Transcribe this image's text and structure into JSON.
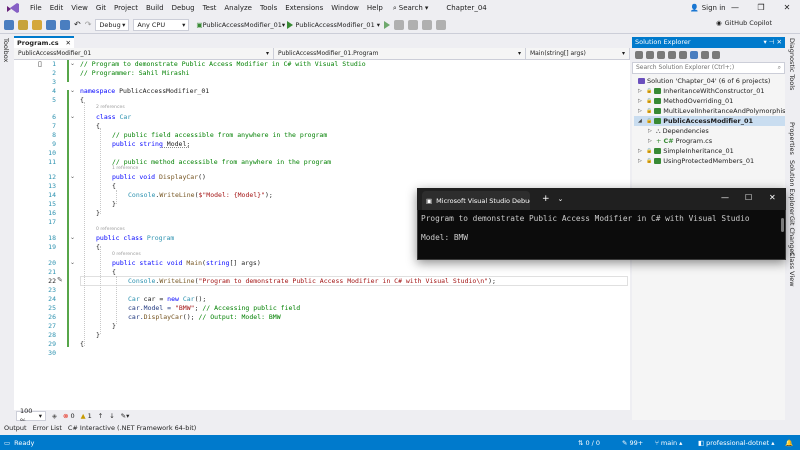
{
  "menu": {
    "items": [
      "File",
      "Edit",
      "View",
      "Git",
      "Project",
      "Build",
      "Debug",
      "Test",
      "Analyze",
      "Tools",
      "Extensions",
      "Window",
      "Help"
    ],
    "search_label": "Search",
    "solution_name": "Chapter_04",
    "sign_in": "Sign in"
  },
  "toolbar": {
    "config": "Debug",
    "platform": "Any CPU",
    "startup_project": "PublicAccessModifier_01",
    "run_label": "PublicAccessModifier_01",
    "copilot": "GitHub Copilot"
  },
  "left_strip": "Toolbox",
  "editor": {
    "tab": "Program.cs",
    "nav_project": "PublicAccessModifier_01",
    "nav_class": "PublicAccessModifier_01.Program",
    "nav_member": "Main(string[] args)",
    "lens_2": "2 references",
    "lens_1": "1 reference",
    "lens_0": "0 references",
    "line_numbers": [
      "1",
      "2",
      "3",
      "4",
      "5",
      "6",
      "7",
      "8",
      "9",
      "10",
      "11",
      "12",
      "13",
      "14",
      "15",
      "16",
      "17",
      "18",
      "19",
      "20",
      "21",
      "22",
      "23",
      "24",
      "25",
      "26",
      "27",
      "28",
      "29",
      "30"
    ],
    "code": {
      "l1": "// Program to demonstrate Public Access Modifier in C# with Visual Studio",
      "l2": "// Programmer: Sahil Mirashi",
      "l4_kw": "namespace",
      "l4_name": " PublicAccessModifier_01",
      "l5": "{",
      "l6_kw": "class",
      "l6_name": " Car",
      "l7": "{",
      "l8": "// public field accessible from anywhere in the program",
      "l9_kw1": "public",
      "l9_kw2": " string",
      "l9_rest": " Model;",
      "l11": "// public method accessible from anywhere in the program",
      "l12_kw1": "public",
      "l12_kw2": " void",
      "l12_name": " DisplayCar",
      "l12_rest": "()",
      "l13": "{",
      "l14_type": "Console",
      "l14_mid": ".",
      "l14_method": "WriteLine",
      "l14_open": "(",
      "l14_str": "$\"Model: {Model}\"",
      "l14_end": ");",
      "l15": "}",
      "l16": "}",
      "l18_kw1": "public",
      "l18_kw2": " class",
      "l18_name": " Program",
      "l19": "{",
      "l20_kw1": "public",
      "l20_kw2": " static",
      "l20_kw3": " void",
      "l20_name": " Main",
      "l20_open": "(",
      "l20_kw4": "string",
      "l20_rest": "[] args)",
      "l21": "{",
      "l22_type": "Console",
      "l22_mid": ".",
      "l22_method": "WriteLine",
      "l22_open": "(",
      "l22_str": "\"Program to demonstrate Public Access Modifier in C# with Visual Studio\\n\"",
      "l22_end": ");",
      "l24_type1": "Car",
      "l24_mid": " car = ",
      "l24_kw": "new",
      "l24_type2": " Car",
      "l24_end": "();",
      "l25_pre": "car.Model = ",
      "l25_str": "\"BMW\"",
      "l25_mid": "; ",
      "l25_cmt": "// Accessing public field",
      "l26_pre": "car.",
      "l26_method": "DisplayCar",
      "l26_mid": "(); ",
      "l26_cmt": "// Output: Model: BMW",
      "l27": "}",
      "l28": "}"
    },
    "zoom": "100 %",
    "errors": "0",
    "warnings": "1"
  },
  "bottom_tabs": [
    "Output",
    "Error List",
    "C# Interactive (.NET Framework 64-bit)"
  ],
  "status": {
    "ready": "Ready",
    "changes": "0 / 0",
    "commits": "99+",
    "branch": "main",
    "repo": "professional-dotnet"
  },
  "solution_explorer": {
    "title": "Solution Explorer",
    "search_placeholder": "Search Solution Explorer (Ctrl+;)",
    "solution": "Solution 'Chapter_04' (6 of 6 projects)",
    "projects": [
      "InheritanceWithConstructor_01",
      "MethodOverriding_01",
      "MultiLevelInheritanceAndPolymorphism_01",
      "PublicAccessModifier_01"
    ],
    "dependencies": "Dependencies",
    "file": "Program.cs",
    "more_projects": [
      "SimpleInheritance_01",
      "UsingProtectedMembers_01"
    ]
  },
  "right_strip": [
    "Diagnostic Tools",
    "Properties",
    "Solution Explorer",
    "Git Changes",
    "Class View"
  ],
  "console": {
    "tab_title": "Microsoft Visual Studio Debug",
    "output": [
      "Program to demonstrate Public Access Modifier in C# with Visual Studio",
      "",
      "Model: BMW"
    ]
  },
  "colors": {
    "accent": "#007acc",
    "status_bar": "#007acc",
    "keyword": "#0000ff",
    "type": "#2b91af",
    "comment": "#008000",
    "string": "#a31515",
    "console_bg": "#0c0c0c"
  }
}
